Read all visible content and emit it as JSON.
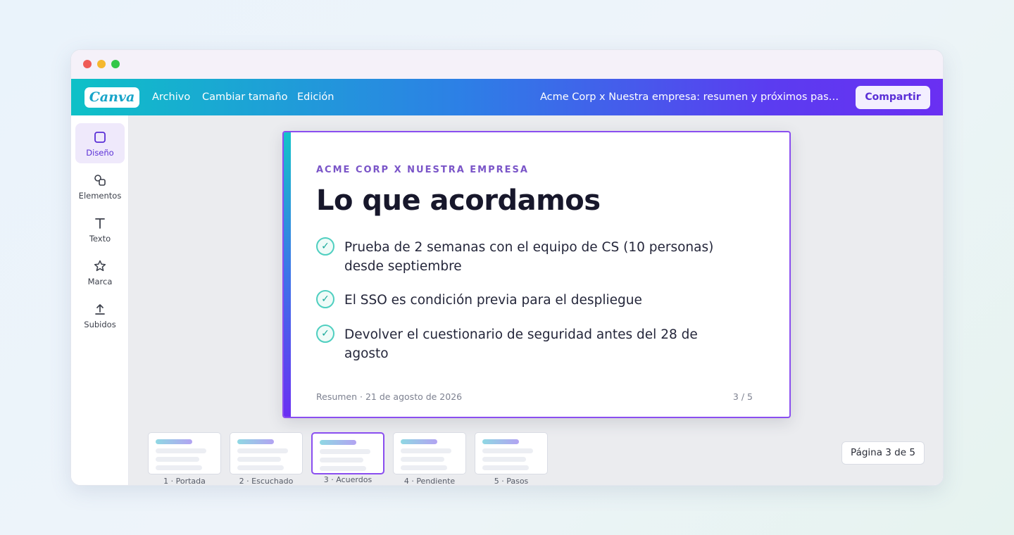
{
  "app": {
    "logo_text": "Canva",
    "menu": [
      "Archivo",
      "Cambiar tamaño",
      "Edición"
    ],
    "document_title": "Acme Corp x Nuestra empresa: resumen y próximos pas…",
    "share_label": "Compartir"
  },
  "sidebar": {
    "items": [
      {
        "label": "Diseño",
        "icon": "square-icon",
        "active": true
      },
      {
        "label": "Elementos",
        "icon": "shapes-icon",
        "active": false
      },
      {
        "label": "Texto",
        "icon": "text-icon",
        "active": false
      },
      {
        "label": "Marca",
        "icon": "star-icon",
        "active": false
      },
      {
        "label": "Subidos",
        "icon": "upload-icon",
        "active": false
      }
    ]
  },
  "slide": {
    "eyebrow": "ACME CORP X NUESTRA EMPRESA",
    "title": "Lo que acordamos",
    "bullets": [
      "Prueba de 2 semanas con el equipo de CS (10 personas) desde septiembre",
      "El SSO es condición previa para el despliegue",
      "Devolver el cuestionario de seguridad antes del 28 de agosto"
    ],
    "check_glyph": "✓",
    "footer": "Resumen · 21 de agosto de 2026",
    "number": "3 / 5"
  },
  "thumbnails": [
    {
      "label": "1 · Portada",
      "active": false
    },
    {
      "label": "2 · Escuchado",
      "active": false
    },
    {
      "label": "3 · Acuerdos",
      "active": true
    },
    {
      "label": "4 · Pendiente",
      "active": false
    },
    {
      "label": "5 · Pasos",
      "active": false
    }
  ],
  "page_indicator": "Página 3 de 5",
  "colors": {
    "accent": "#8a4ef0",
    "brand_gradient_start": "#0ec1c7",
    "brand_gradient_end": "#6a2ff2",
    "check": "#4fcfc0"
  }
}
